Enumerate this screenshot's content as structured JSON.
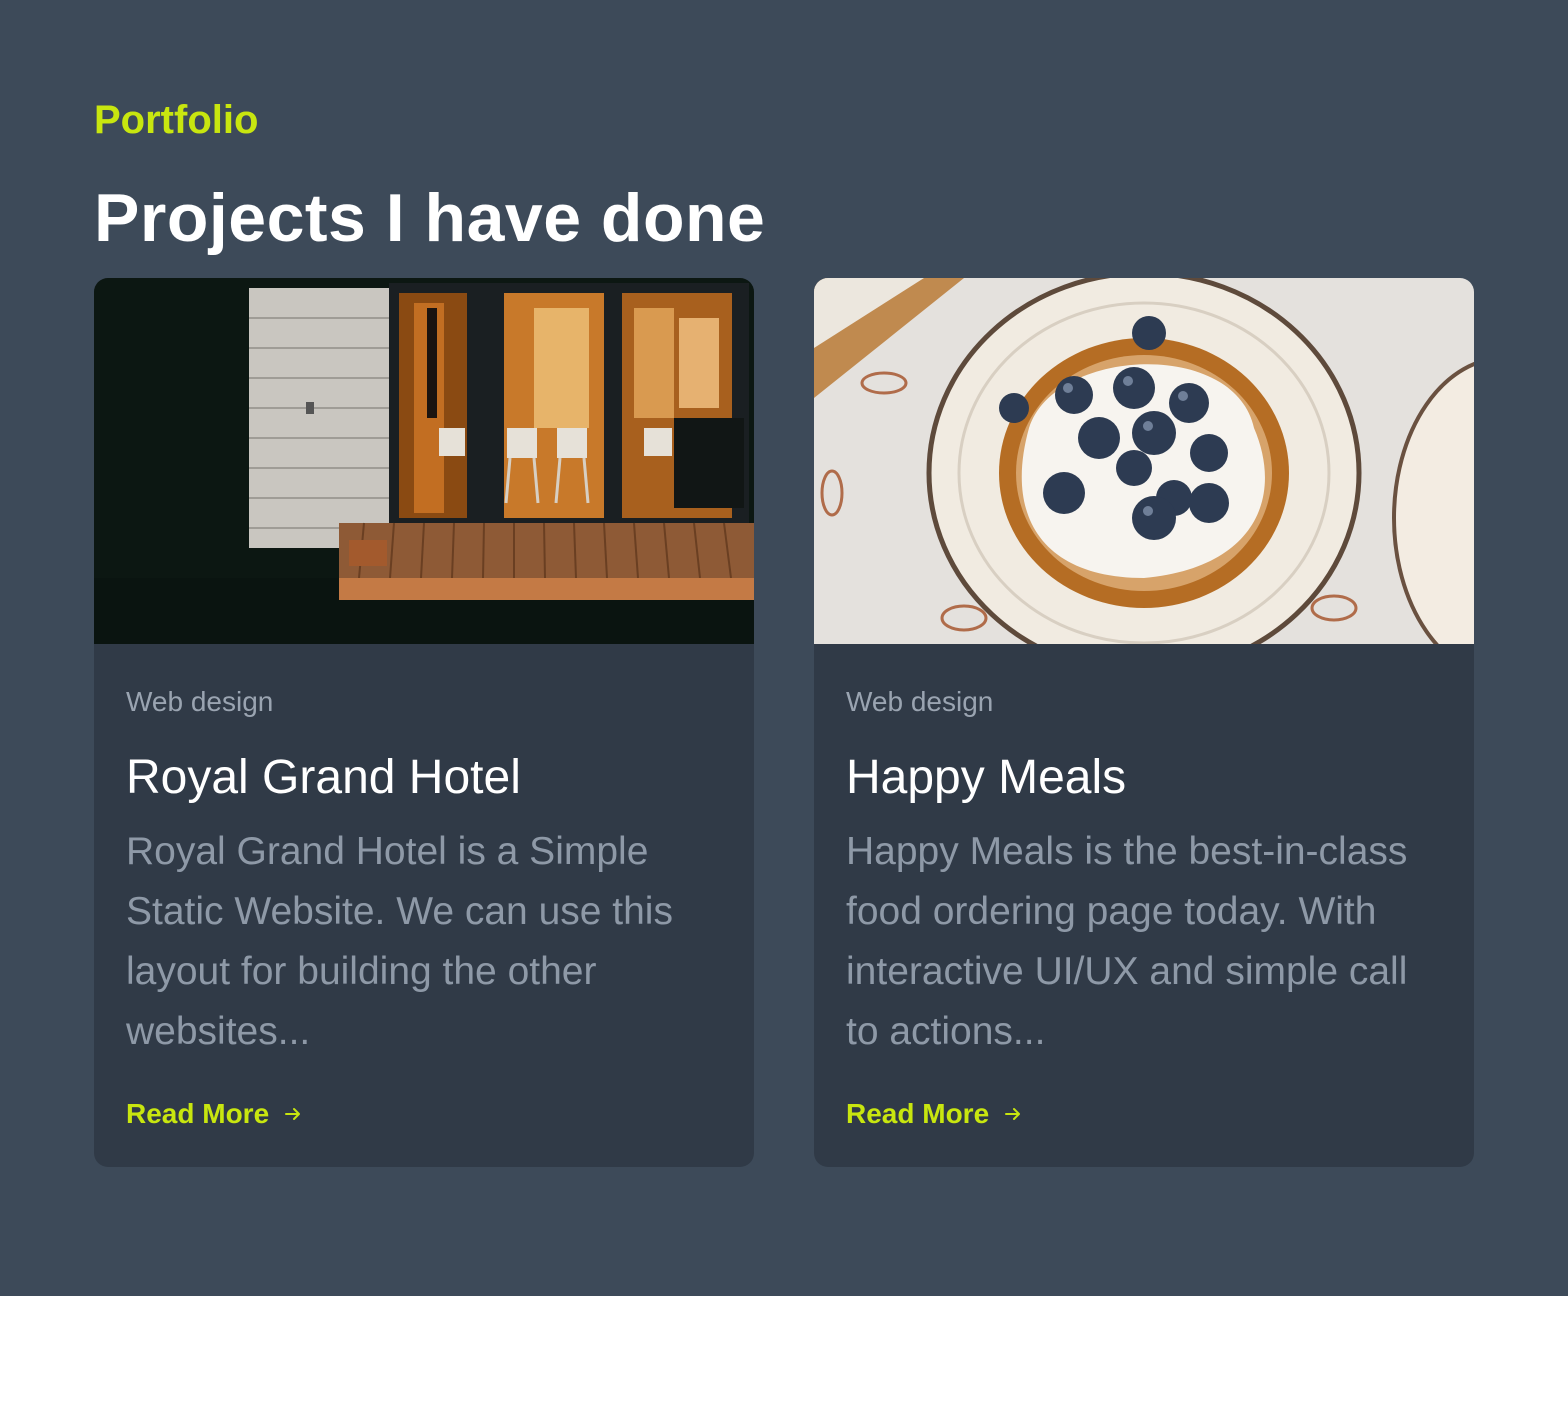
{
  "portfolio": {
    "eyebrow": "Portfolio",
    "heading": "Projects I have done",
    "accent_color": "#c8e60f",
    "projects": [
      {
        "image": "photo of a wooden house deck at night with lit glass doors",
        "category": "Web design",
        "title": "Royal Grand Hotel",
        "description": "Royal Grand Hotel is a Simple Static Website. We can use this layout for building the other websites...",
        "cta_label": "Read More",
        "cta_icon": "arrow-right-icon"
      },
      {
        "image": "photo of waffles topped with cream and blueberries on a plate",
        "category": "Web design",
        "title": "Happy Meals",
        "description": "Happy Meals is the best-in-class food ordering page today. With interactive UI/UX and simple call to actions...",
        "cta_label": "Read More",
        "cta_icon": "arrow-right-icon"
      }
    ]
  }
}
